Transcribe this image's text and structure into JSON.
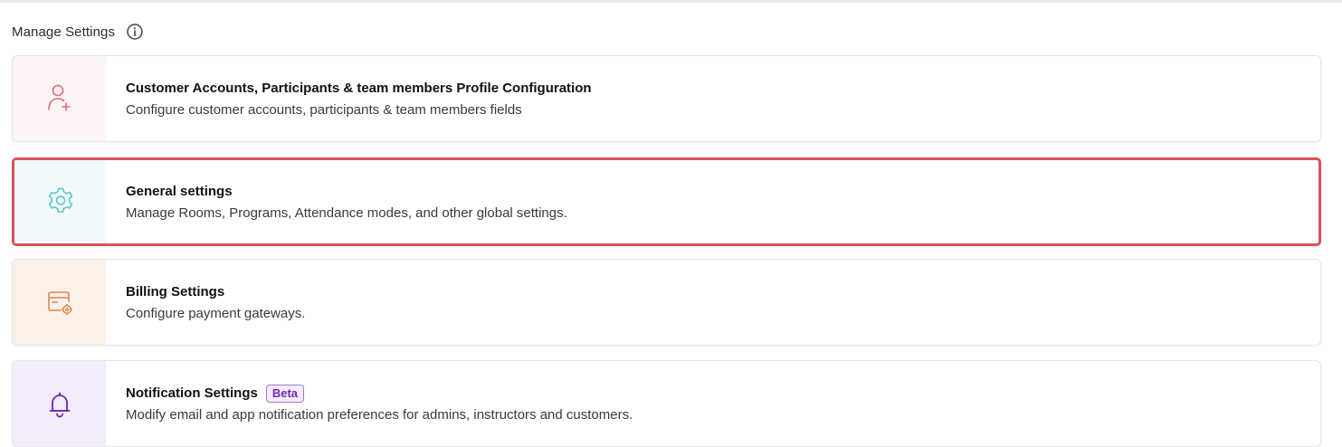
{
  "header": {
    "title": "Manage Settings",
    "info_icon": "info-icon"
  },
  "cards": [
    {
      "title": "Customer Accounts, Participants & team members Profile Configuration",
      "description": "Configure customer accounts, participants & team members fields",
      "icon": "user-plus-icon",
      "panel_color": "#fdf4f6",
      "icon_color": "#e06a86"
    },
    {
      "title": "General settings",
      "description": "Manage Rooms, Programs, Attendance modes, and other global settings.",
      "icon": "gear-icon",
      "panel_color": "#f1fafb",
      "icon_color": "#58c0c9",
      "selected": true
    },
    {
      "title": "Billing Settings",
      "description": "Configure payment gateways.",
      "icon": "billing-gear-icon",
      "panel_color": "#fdf0e8",
      "icon_color": "#e08552"
    },
    {
      "title": "Notification Settings",
      "badge": "Beta",
      "description": "Modify email and app notification preferences for admins, instructors and customers.",
      "icon": "bell-icon",
      "panel_color": "#f3ecfb",
      "icon_color": "#6d2bb0"
    }
  ],
  "colors": {
    "selected_border": "#d9535a",
    "badge_text": "#6d2bb0"
  }
}
